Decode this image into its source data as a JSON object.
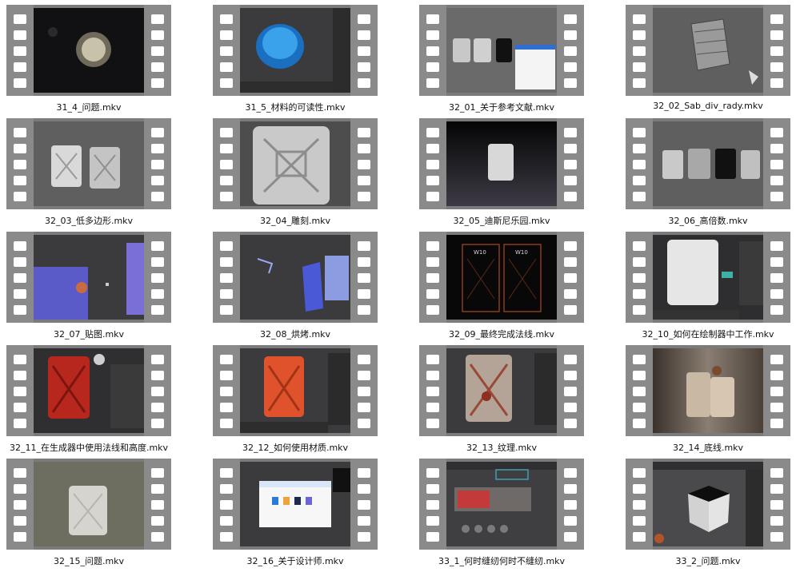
{
  "files": [
    {
      "name": "31_4_问题.mkv",
      "scene": "dark",
      "object": "cap"
    },
    {
      "name": "31_5_材料的可读性.mkv",
      "scene": "ui",
      "object": "button"
    },
    {
      "name": "32_01_关于参考文献.mkv",
      "scene": "light",
      "object": "cans_ref"
    },
    {
      "name": "32_02_Sab_div_rady.mkv",
      "scene": "grey",
      "object": "can_wire"
    },
    {
      "name": "32_03_低多边形.mkv",
      "scene": "grey",
      "object": "cans_two"
    },
    {
      "name": "32_04_雕刻.mkv",
      "scene": "grey",
      "object": "can_close"
    },
    {
      "name": "32_05_迪斯尼乐园.mkv",
      "scene": "dark",
      "object": "can_white"
    },
    {
      "name": "32_06_高倍数.mkv",
      "scene": "grey",
      "object": "cans_maps"
    },
    {
      "name": "32_07_贴图.mkv",
      "scene": "ui",
      "object": "blue_normal"
    },
    {
      "name": "32_08_烘烤.mkv",
      "scene": "ui",
      "object": "blue_uv"
    },
    {
      "name": "32_09_最终完成法线.mkv",
      "scene": "black",
      "object": "wireframe"
    },
    {
      "name": "32_10_如何在绘制器中工作.mkv",
      "scene": "ui",
      "object": "can_white_big"
    },
    {
      "name": "32_11_在生成器中使用法线和高度.mkv",
      "scene": "ui",
      "object": "can_red"
    },
    {
      "name": "32_12_如何使用材质.mkv",
      "scene": "ui",
      "object": "can_orange"
    },
    {
      "name": "32_13_纹理.mkv",
      "scene": "ui",
      "object": "can_rust"
    },
    {
      "name": "32_14_底线.mkv",
      "scene": "photo",
      "object": "cans_rust"
    },
    {
      "name": "32_15_问题.mkv",
      "scene": "olive",
      "object": "can_clay"
    },
    {
      "name": "32_16_关于设计师.mkv",
      "scene": "ui",
      "object": "explorer"
    },
    {
      "name": "33_1_何时缝纫何时不缝纫.mkv",
      "scene": "ui",
      "object": "uv_red"
    },
    {
      "name": "33_2_问题.mkv",
      "scene": "ui",
      "object": "cube"
    }
  ],
  "colors": {
    "film": "#7b7b7b",
    "hole": "#ffffff",
    "caption": "#111111"
  }
}
